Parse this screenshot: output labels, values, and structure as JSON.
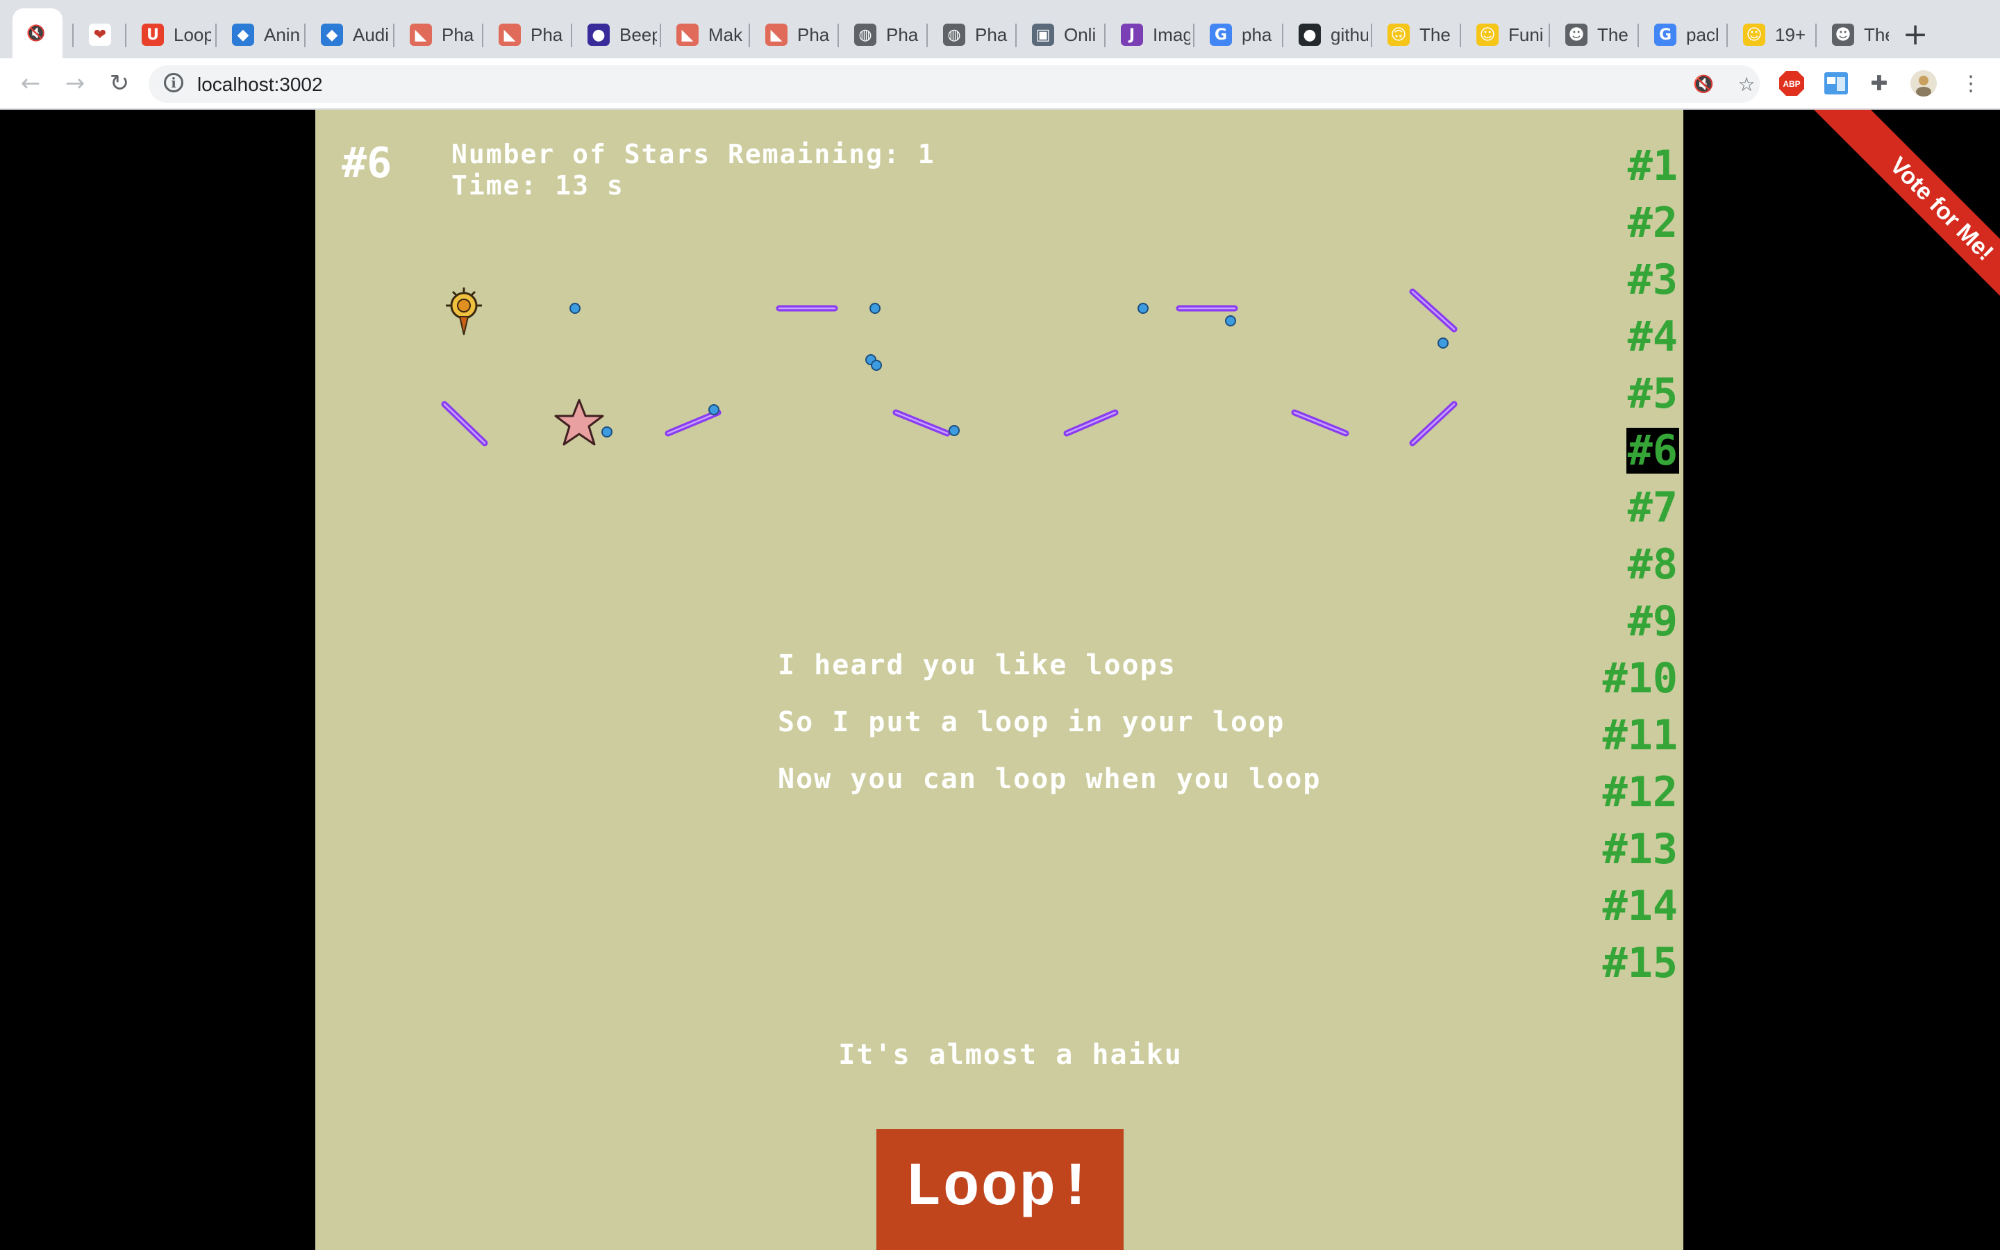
{
  "browser": {
    "tabs": [
      {
        "label": "",
        "icon": "muted-speaker-icon",
        "color": "#ffffff",
        "glyph": "🔇"
      },
      {
        "label": "",
        "icon": "pixel-heart-icon",
        "color": "#ffffff",
        "glyph": "❤"
      },
      {
        "label": "Loop",
        "icon": "udacity-icon",
        "color": "#e8402b",
        "glyph": "U"
      },
      {
        "label": "Anin",
        "icon": "blue-puzzle-icon",
        "color": "#2c7bd6",
        "glyph": "◆"
      },
      {
        "label": "Audi",
        "icon": "blue-puzzle-icon",
        "color": "#2c7bd6",
        "glyph": "◆"
      },
      {
        "label": "Pha",
        "icon": "phaser-icon",
        "color": "#e06b5a",
        "glyph": "◣"
      },
      {
        "label": "Pha",
        "icon": "phaser-icon",
        "color": "#e06b5a",
        "glyph": "◣"
      },
      {
        "label": "Beep",
        "icon": "beepbox-icon",
        "color": "#3a2b9b",
        "glyph": "●"
      },
      {
        "label": "Mak",
        "icon": "phaser-icon",
        "color": "#e06b5a",
        "glyph": "◣"
      },
      {
        "label": "Pha",
        "icon": "phaser-icon",
        "color": "#e06b5a",
        "glyph": "◣"
      },
      {
        "label": "Pha",
        "icon": "globe-icon",
        "color": "#5f6368",
        "glyph": "◍"
      },
      {
        "label": "Pha",
        "icon": "globe-icon",
        "color": "#5f6368",
        "glyph": "◍"
      },
      {
        "label": "Onli",
        "icon": "image-tool-icon",
        "color": "#5a6a7a",
        "glyph": "▣"
      },
      {
        "label": "Imag",
        "icon": "jpg-icon",
        "color": "#7b3fb5",
        "glyph": "J"
      },
      {
        "label": "pha",
        "icon": "google-icon",
        "color": "#4285f4",
        "glyph": "G"
      },
      {
        "label": "githu",
        "icon": "github-icon",
        "color": "#24292e",
        "glyph": "●"
      },
      {
        "label": "The",
        "icon": "upside-down-emoji-icon",
        "color": "#f5c518",
        "glyph": "🙃"
      },
      {
        "label": "Funi",
        "icon": "smiley-icon",
        "color": "#f5c518",
        "glyph": "☺"
      },
      {
        "label": "The",
        "icon": "troll-face-icon",
        "color": "#5f6368",
        "glyph": "☻"
      },
      {
        "label": "pacl",
        "icon": "google-icon",
        "color": "#4285f4",
        "glyph": "G"
      },
      {
        "label": "19+",
        "icon": "grin-emoji-icon",
        "color": "#f5c518",
        "glyph": "☺"
      },
      {
        "label": "The",
        "icon": "troll-face-icon",
        "color": "#5f6368",
        "glyph": "☻"
      }
    ],
    "url": "localhost:3002"
  },
  "game": {
    "current_level": "#6",
    "stars_remaining_text": "Number of Stars Remaining: 1",
    "time_text": "Time: 13 s",
    "levels": [
      "#1",
      "#2",
      "#3",
      "#4",
      "#5",
      "#6",
      "#7",
      "#8",
      "#9",
      "#10",
      "#11",
      "#12",
      "#13",
      "#14",
      "#15"
    ],
    "selected_level_index": 5,
    "haiku": [
      "I heard you like loops",
      "So I put a loop in your loop",
      "Now you can loop when you loop"
    ],
    "almost_haiku": "It's almost a haiku",
    "loop_button": "Loop!",
    "ribbon": "Vote for Me!",
    "colors": {
      "background": "#cccc9e",
      "level_link": "#34a536",
      "platform": "#8a3cf0",
      "dot": "#3d9ce0",
      "button": "#c0441c",
      "ribbon": "#d52b1e"
    }
  }
}
